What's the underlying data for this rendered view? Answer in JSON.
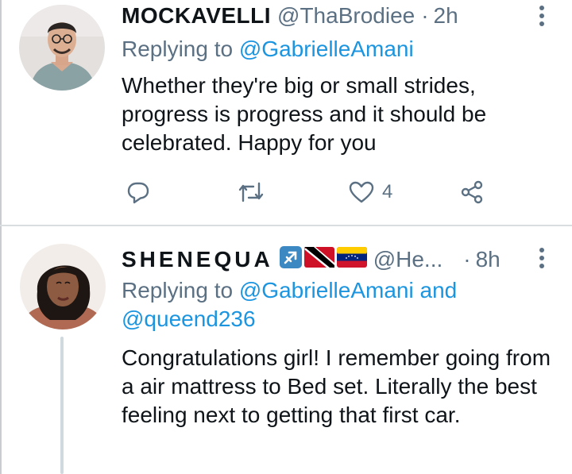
{
  "tweets": [
    {
      "name": "MOCKAVELLI",
      "handle": "@ThaBrodiee",
      "separator": "·",
      "time": "2h",
      "replying_prefix": "Replying to ",
      "replying_mentions": "@GabrielleAmani",
      "text": "Whether they're big or small strides, progress is progress and it should be celebrated. Happy for you",
      "actions": {
        "reply_icon": "reply-icon",
        "retweet_icon": "retweet-icon",
        "like_icon": "heart-icon",
        "like_count": "4",
        "share_icon": "share-icon"
      }
    },
    {
      "name": "SHENEQUA",
      "handle": "@He...",
      "separator": "·",
      "time": "8h",
      "badges": [
        "sagittarius-icon",
        "trinidad-flag-icon",
        "venezuela-flag-icon"
      ],
      "replying_prefix": "Replying to ",
      "replying_mentions": "@GabrielleAmani and @queend236",
      "text": "Congratulations girl! I remember going from a air mattress to Bed set. Literally the best feeling next to getting that first car."
    }
  ],
  "colors": {
    "link": "#1b95e0",
    "secondary": "#5b7083",
    "text": "#0f1419",
    "divider": "#d9dde0"
  }
}
